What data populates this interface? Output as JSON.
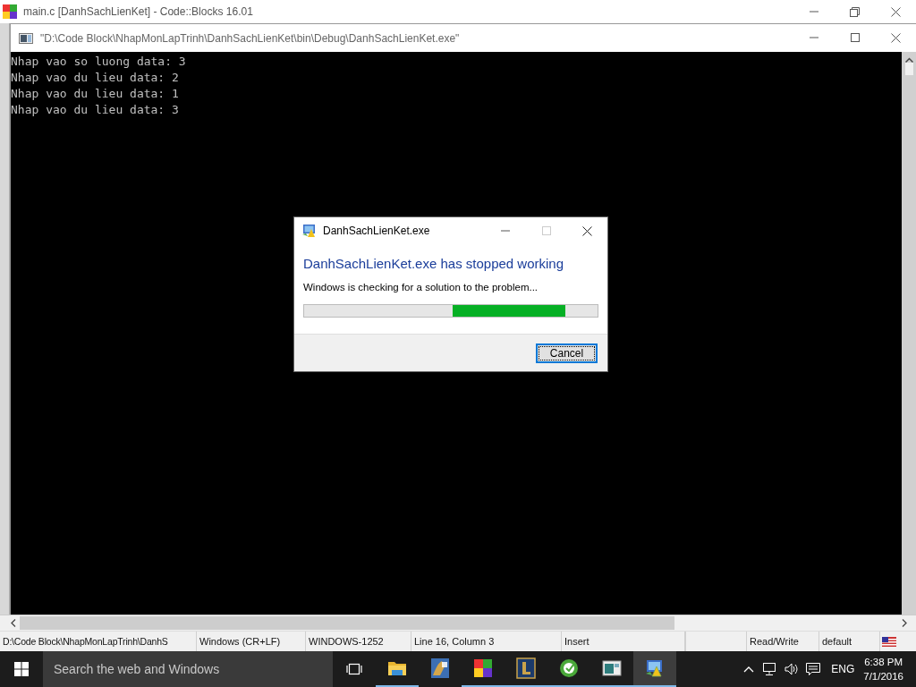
{
  "ide": {
    "title": "main.c [DanhSachLienKet] - Code::Blocks 16.01"
  },
  "console": {
    "title": "\"D:\\Code Block\\NhapMonLapTrinh\\DanhSachLienKet\\bin\\Debug\\DanhSachLienKet.exe\"",
    "lines": [
      "Nhap vao so luong data: 3",
      "Nhap vao du lieu data: 2",
      "Nhap vao du lieu data: 1",
      "Nhap vao du lieu data: 3"
    ]
  },
  "dialog": {
    "title": "DanhSachLienKet.exe",
    "heading": "DanhSachLienKet.exe has stopped working",
    "message": "Windows is checking for a solution to the problem...",
    "progress": {
      "indeterminate": true
    },
    "button": {
      "label": "Cancel",
      "focused": true
    }
  },
  "status_bar": [
    "D:\\Code Block\\NhapMonLapTrinh\\DanhS",
    "Windows (CR+LF)",
    "WINDOWS-1252",
    "Line 16, Column 3",
    "Insert",
    "Read/Write",
    "default"
  ],
  "taskbar": {
    "search": {
      "placeholder": "Search the web and Windows"
    },
    "apps": [
      {
        "kind": "folder",
        "running": true,
        "active": false
      },
      {
        "kind": "fpc",
        "running": false,
        "active": false
      },
      {
        "kind": "squares",
        "running": true,
        "active": false
      },
      {
        "kind": "letter",
        "running": true,
        "active": false
      },
      {
        "kind": "dict",
        "running": true,
        "active": false
      },
      {
        "kind": "window",
        "running": true,
        "active": false
      },
      {
        "kind": "error",
        "running": true,
        "active": true
      }
    ],
    "language": "ENG",
    "time": "6:38 PM",
    "date": "7/1/2016"
  }
}
